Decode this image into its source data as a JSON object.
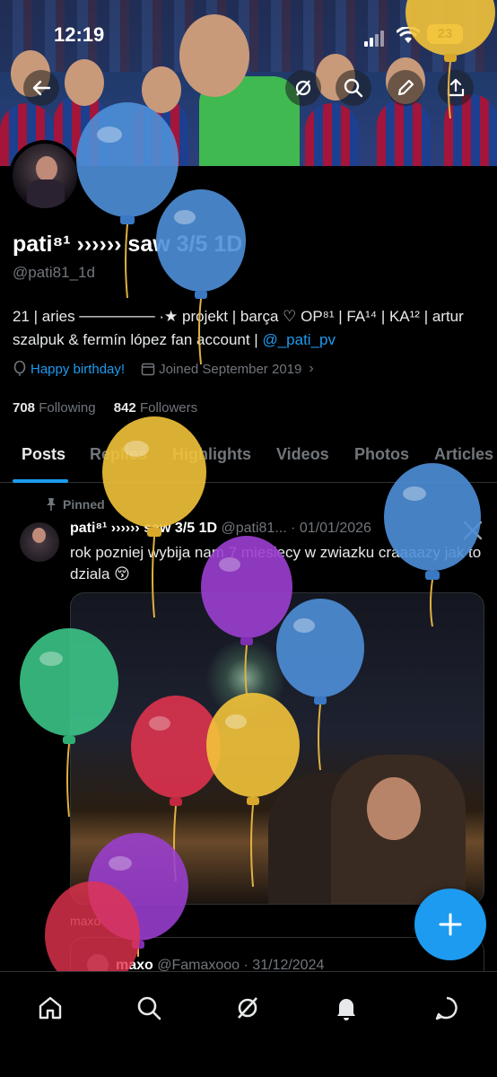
{
  "status_bar": {
    "time": "12:19",
    "battery": "23"
  },
  "profile": {
    "display_name": "pati⁸¹ ›››››› saw 3/5 1D",
    "handle": "@pati81_1d",
    "bio_text": "21 | aries ─────── ·★ projekt | barça ♡ OP⁸¹ | FA¹⁴ | KA¹² | artur szalpuk & fermín lópez fan account | ",
    "bio_link": "@_pati_pv",
    "birthday": "Happy birthday!",
    "joined": "Joined September 2019",
    "following_count": "708",
    "following_label": "Following",
    "followers_count": "842",
    "followers_label": "Followers"
  },
  "tabs": [
    "Posts",
    "Replies",
    "Highlights",
    "Videos",
    "Photos",
    "Articles"
  ],
  "pinned_label": "Pinned",
  "post": {
    "name": "pati⁸¹ ›››››› saw 3/5 1D",
    "meta": " @pati81... · 01/01/2026",
    "text": "rok pozniej wybija nam 7 miesiecy w zwiazku craaaazy jak to dziala 😚"
  },
  "repost": {
    "label": "maxo",
    "name": "maxo",
    "meta": " @Famaxooo · 31/12/2024"
  },
  "icons": [
    "back-icon",
    "grok-icon",
    "search-icon",
    "edit-icon",
    "share-icon",
    "home-icon",
    "explore-icon",
    "bell-icon",
    "messages-icon",
    "plus-icon",
    "x-logo-icon",
    "pin-icon",
    "balloon-icon",
    "calendar-icon"
  ],
  "colors": {
    "accent": "#1d9bf0",
    "muted": "#71767b",
    "text": "#e7e9ea",
    "background": "#000000"
  }
}
